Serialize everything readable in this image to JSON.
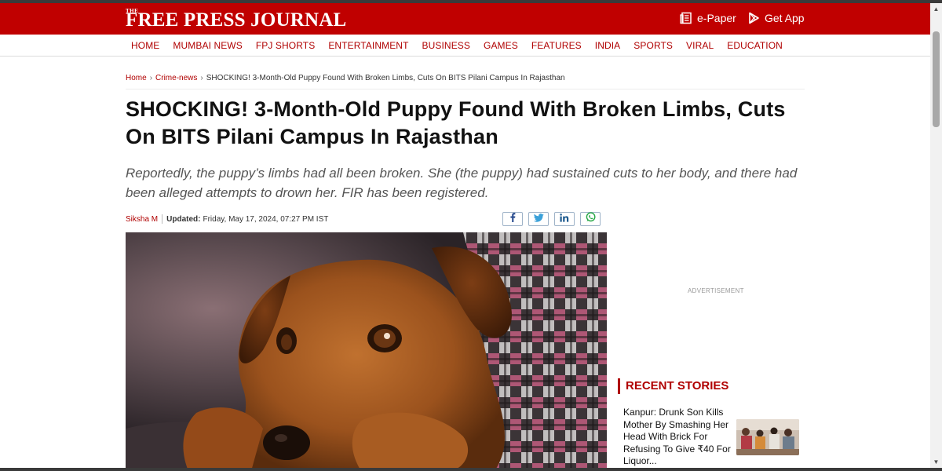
{
  "site": {
    "logo_the": "THE",
    "logo_name": "FREE PRESS JOURNAL",
    "epaper_label": "e-Paper",
    "getapp_label": "Get App"
  },
  "nav": {
    "items": [
      "HOME",
      "MUMBAI NEWS",
      "FPJ SHORTS",
      "ENTERTAINMENT",
      "BUSINESS",
      "GAMES",
      "FEATURES",
      "INDIA",
      "SPORTS",
      "VIRAL",
      "EDUCATION"
    ]
  },
  "breadcrumb": {
    "home": "Home",
    "section": "Crime-news",
    "current": "SHOCKING! 3-Month-Old Puppy Found With Broken Limbs, Cuts On BITS Pilani Campus In Rajasthan",
    "separator": "›"
  },
  "article": {
    "headline": "SHOCKING! 3-Month-Old Puppy Found With Broken Limbs, Cuts On BITS Pilani Campus In Rajasthan",
    "summary": "Reportedly, the puppy’s limbs had all been broken. She (the puppy) had sustained cuts to her body, and there had been alleged attempts to drown her. FIR has been registered.",
    "author": "Siksha M",
    "updated_label": "Updated:",
    "updated_value": "Friday, May 17, 2024, 07:27 PM IST"
  },
  "share": {
    "buttons": [
      "facebook-icon",
      "twitter-icon",
      "linkedin-icon",
      "whatsapp-icon"
    ]
  },
  "sidebar": {
    "ad_label": "ADVERTISEMENT",
    "recent_title": "RECENT STORIES",
    "stories": [
      {
        "title": "Kanpur: Drunk Son Kills Mother By Smashing Her Head With Brick For Refusing To Give ₹40 For Liquor..."
      }
    ]
  },
  "colors": {
    "brand_red": "#c00000",
    "link_red": "#b00000"
  }
}
